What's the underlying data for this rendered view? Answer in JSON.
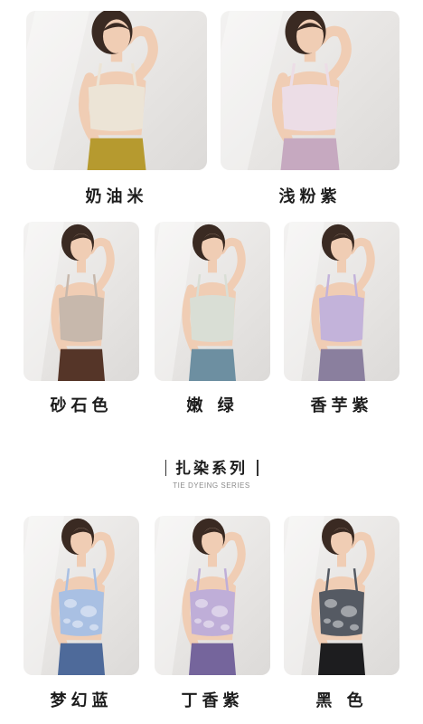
{
  "products": [
    {
      "label": "奶油米",
      "top_color": "#ece4d6",
      "bottom_color": "#b69a2f",
      "hair_color": "#3a2a22"
    },
    {
      "label": "浅粉紫",
      "top_color": "#ecdde6",
      "bottom_color": "#c6a9c0",
      "hair_color": "#3a2a22"
    },
    {
      "label": "砂石色",
      "top_color": "#c7b8ac",
      "bottom_color": "#553528",
      "hair_color": "#3a2a22"
    },
    {
      "label": "嫩 绿",
      "top_color": "#d9ded5",
      "bottom_color": "#6d8fa1",
      "hair_color": "#3a2a22"
    },
    {
      "label": "香芋紫",
      "top_color": "#c3b3da",
      "bottom_color": "#8a7f9e",
      "hair_color": "#3a2a22"
    }
  ],
  "tie_dye_section": {
    "title": "扎染系列",
    "subtitle": "TIE DYEING SERIES"
  },
  "tie_dye_products": [
    {
      "label": "梦幻蓝",
      "top_color": "#a9c0e3",
      "bottom_color": "#4e6a9a",
      "hair_color": "#3a2a22"
    },
    {
      "label": "丁香紫",
      "top_color": "#bfaed8",
      "bottom_color": "#75659c",
      "hair_color": "#3a2a22"
    },
    {
      "label": "黑 色",
      "top_color": "#555a63",
      "bottom_color": "#1d1d1f",
      "hair_color": "#3a2a22"
    }
  ]
}
